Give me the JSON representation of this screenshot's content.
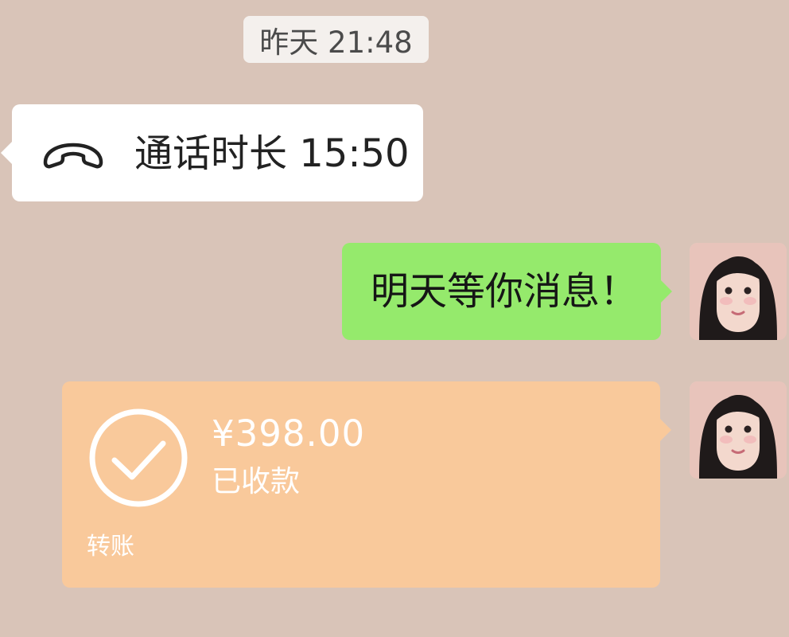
{
  "timestamp": "昨天 21:48",
  "messages": {
    "call": {
      "text": "通话时长 15:50",
      "icon": "phone-hangup-icon",
      "bubble_color": "#ffffff"
    },
    "text_message": {
      "text": "明天等你消息！",
      "bubble_color": "#95ea6c"
    },
    "transfer": {
      "amount": "¥398.00",
      "status": "已收款",
      "footer": "转账",
      "icon": "checkmark-circle-icon",
      "bubble_color": "#f9c99b"
    }
  },
  "colors": {
    "background": "#d9c4b8",
    "timestamp_bg": "#f4f0ed",
    "text_dark": "#222222",
    "white": "#ffffff"
  }
}
